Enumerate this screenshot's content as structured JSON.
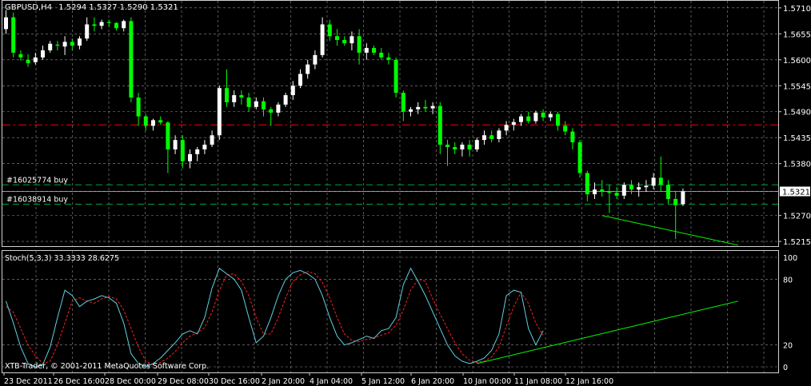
{
  "header": {
    "title": "GBPUSD,H4",
    "ohlc": "1.5294 1.5327 1.5290 1.5321"
  },
  "footer": {
    "copyright": "XTB-Trader, © 2001-2011 MetaQuotes Software Corp."
  },
  "orders": [
    {
      "label": "#16025774 buy",
      "price": 1.5335
    },
    {
      "label": "#16038914 buy",
      "price": 1.5294
    }
  ],
  "colors": {
    "background": "#000000",
    "bull": "#ffffff",
    "bear": "#00ff00",
    "grid": "#c0c0c0",
    "resistance": "#ff0000",
    "order_line": "#00a040",
    "stoch_main": "#5fd0e0",
    "stoch_signal": "#ff2020",
    "trendline": "#00ff00"
  },
  "chart_data": [
    {
      "type": "candlestick",
      "title": "GBPUSD,H4",
      "symbol": "GBPUSD",
      "timeframe": "H4",
      "current_price": "1.5321",
      "y_ticks": [
        "1.5710",
        "1.5655",
        "1.5600",
        "1.5545",
        "1.5490",
        "1.5435",
        "1.5380",
        "1.5321",
        "1.5270",
        "1.5215"
      ],
      "ylim": [
        1.5205,
        1.5725
      ],
      "grid": true,
      "resistance_level": 1.5462,
      "candles": [
        [
          1.5665,
          1.5705,
          1.5655,
          1.569
        ],
        [
          1.569,
          1.57,
          1.5605,
          1.5615
        ],
        [
          1.5612,
          1.562,
          1.5598,
          1.5605
        ],
        [
          1.56,
          1.5612,
          1.5585,
          1.5593
        ],
        [
          1.5595,
          1.5615,
          1.559,
          1.5605
        ],
        [
          1.5605,
          1.563,
          1.56,
          1.562
        ],
        [
          1.562,
          1.564,
          1.5615,
          1.5634
        ],
        [
          1.5632,
          1.564,
          1.562,
          1.563
        ],
        [
          1.5628,
          1.565,
          1.561,
          1.5638
        ],
        [
          1.5638,
          1.5645,
          1.562,
          1.563
        ],
        [
          1.563,
          1.565,
          1.5622,
          1.5645
        ],
        [
          1.5645,
          1.569,
          1.564,
          1.5675
        ],
        [
          1.5675,
          1.569,
          1.566,
          1.5672
        ],
        [
          1.5672,
          1.5685,
          1.5665,
          1.568
        ],
        [
          1.568,
          1.5685,
          1.567,
          1.5678
        ],
        [
          1.5678,
          1.568,
          1.5662,
          1.5667
        ],
        [
          1.5667,
          1.5685,
          1.566,
          1.5682
        ],
        [
          1.5682,
          1.569,
          1.551,
          1.552
        ],
        [
          1.552,
          1.553,
          1.546,
          1.548
        ],
        [
          1.548,
          1.5485,
          1.545,
          1.546
        ],
        [
          1.546,
          1.5475,
          1.545,
          1.5472
        ],
        [
          1.5472,
          1.548,
          1.5462,
          1.5467
        ],
        [
          1.5467,
          1.547,
          1.536,
          1.541
        ],
        [
          1.541,
          1.544,
          1.54,
          1.543
        ],
        [
          1.543,
          1.544,
          1.537,
          1.5385
        ],
        [
          1.5385,
          1.541,
          1.537,
          1.54
        ],
        [
          1.54,
          1.5415,
          1.5385,
          1.541
        ],
        [
          1.541,
          1.543,
          1.54,
          1.542
        ],
        [
          1.542,
          1.545,
          1.5415,
          1.544
        ],
        [
          1.544,
          1.5545,
          1.543,
          1.554
        ],
        [
          1.554,
          1.558,
          1.55,
          1.551
        ],
        [
          1.551,
          1.5535,
          1.55,
          1.5525
        ],
        [
          1.5525,
          1.5535,
          1.5505,
          1.552
        ],
        [
          1.552,
          1.553,
          1.549,
          1.55
        ],
        [
          1.55,
          1.552,
          1.5495,
          1.5512
        ],
        [
          1.5512,
          1.552,
          1.548,
          1.5495
        ],
        [
          1.5495,
          1.55,
          1.546,
          1.5488
        ],
        [
          1.5488,
          1.551,
          1.548,
          1.5505
        ],
        [
          1.5505,
          1.553,
          1.55,
          1.5525
        ],
        [
          1.5525,
          1.5555,
          1.5515,
          1.5545
        ],
        [
          1.5545,
          1.558,
          1.554,
          1.557
        ],
        [
          1.557,
          1.56,
          1.556,
          1.559
        ],
        [
          1.559,
          1.562,
          1.558,
          1.561
        ],
        [
          1.561,
          1.569,
          1.5605,
          1.5675
        ],
        [
          1.5675,
          1.5685,
          1.564,
          1.565
        ],
        [
          1.565,
          1.5665,
          1.563,
          1.5642
        ],
        [
          1.5642,
          1.565,
          1.563,
          1.5635
        ],
        [
          1.5635,
          1.566,
          1.562,
          1.565
        ],
        [
          1.565,
          1.5665,
          1.559,
          1.5615
        ],
        [
          1.5615,
          1.5635,
          1.56,
          1.5625
        ],
        [
          1.5625,
          1.563,
          1.561,
          1.5615
        ],
        [
          1.5615,
          1.5625,
          1.56,
          1.5605
        ],
        [
          1.5605,
          1.5615,
          1.559,
          1.56
        ],
        [
          1.56,
          1.5605,
          1.552,
          1.553
        ],
        [
          1.553,
          1.5535,
          1.547,
          1.549
        ],
        [
          1.549,
          1.55,
          1.548,
          1.5495
        ],
        [
          1.5495,
          1.551,
          1.5485,
          1.55
        ],
        [
          1.55,
          1.5515,
          1.549,
          1.5497
        ],
        [
          1.5497,
          1.551,
          1.5485,
          1.5502
        ],
        [
          1.5502,
          1.551,
          1.54,
          1.542
        ],
        [
          1.542,
          1.543,
          1.5375,
          1.5415
        ],
        [
          1.5415,
          1.5425,
          1.54,
          1.541
        ],
        [
          1.541,
          1.5425,
          1.5395,
          1.542
        ],
        [
          1.542,
          1.543,
          1.5395,
          1.541
        ],
        [
          1.541,
          1.5435,
          1.5405,
          1.543
        ],
        [
          1.543,
          1.545,
          1.542,
          1.544
        ],
        [
          1.544,
          1.545,
          1.5425,
          1.5432
        ],
        [
          1.5432,
          1.5455,
          1.5425,
          1.545
        ],
        [
          1.545,
          1.547,
          1.544,
          1.5462
        ],
        [
          1.5462,
          1.5475,
          1.545,
          1.5468
        ],
        [
          1.5468,
          1.5485,
          1.546,
          1.548
        ],
        [
          1.548,
          1.549,
          1.5465,
          1.547
        ],
        [
          1.547,
          1.5492,
          1.5465,
          1.5488
        ],
        [
          1.5488,
          1.5495,
          1.547,
          1.5478
        ],
        [
          1.5478,
          1.549,
          1.547,
          1.5485
        ],
        [
          1.5485,
          1.549,
          1.545,
          1.546
        ],
        [
          1.546,
          1.547,
          1.544,
          1.5448
        ],
        [
          1.5448,
          1.5455,
          1.541,
          1.5425
        ],
        [
          1.5425,
          1.543,
          1.535,
          1.536
        ],
        [
          1.536,
          1.5365,
          1.53,
          1.5315
        ],
        [
          1.5315,
          1.534,
          1.5305,
          1.5325
        ],
        [
          1.5325,
          1.5345,
          1.531,
          1.532
        ],
        [
          1.532,
          1.5335,
          1.5275,
          1.5318
        ],
        [
          1.5318,
          1.533,
          1.5305,
          1.5312
        ],
        [
          1.5312,
          1.534,
          1.5305,
          1.5335
        ],
        [
          1.5335,
          1.5345,
          1.5315,
          1.5325
        ],
        [
          1.5325,
          1.534,
          1.531,
          1.533
        ],
        [
          1.533,
          1.5345,
          1.532,
          1.5333
        ],
        [
          1.5333,
          1.536,
          1.5325,
          1.535
        ],
        [
          1.535,
          1.5395,
          1.532,
          1.5335
        ],
        [
          1.5335,
          1.5345,
          1.5295,
          1.5305
        ],
        [
          1.5305,
          1.532,
          1.522,
          1.5292
        ],
        [
          1.5294,
          1.5327,
          1.529,
          1.5321
        ]
      ],
      "trendline": {
        "from": [
          81,
          1.527
        ],
        "to": [
          99.5,
          1.5207
        ]
      }
    },
    {
      "type": "line",
      "title": "Stoch(5,3,3) 33.3333 28.6275",
      "indicator": "Stoch(5,3,3)",
      "main_value": "33.3333",
      "signal_value": "28.6275",
      "y_ticks": [
        "100",
        "80",
        "20",
        "0"
      ],
      "levels": [
        80,
        20
      ],
      "ylim": [
        0,
        100
      ],
      "grid": true,
      "series": [
        {
          "values": [
            60,
            40,
            18,
            3,
            0,
            2,
            18,
            45,
            70,
            65,
            55,
            60,
            62,
            65,
            63,
            58,
            40,
            12,
            3,
            0,
            3,
            8,
            15,
            22,
            30,
            33,
            30,
            45,
            72,
            90,
            85,
            80,
            70,
            45,
            22,
            28,
            45,
            65,
            80,
            86,
            88,
            85,
            80,
            65,
            45,
            28,
            20,
            22,
            25,
            28,
            26,
            33,
            35,
            45,
            75,
            90,
            78,
            65,
            50,
            35,
            20,
            10,
            5,
            3,
            5,
            8,
            15,
            30,
            65,
            70,
            68,
            35,
            20,
            33
          ]
        },
        {
          "values": [
            55,
            50,
            35,
            20,
            10,
            3,
            5,
            20,
            40,
            60,
            63,
            60,
            58,
            62,
            64,
            62,
            52,
            35,
            18,
            5,
            2,
            4,
            8,
            14,
            22,
            28,
            31,
            36,
            50,
            70,
            84,
            85,
            78,
            65,
            45,
            30,
            30,
            45,
            63,
            78,
            84,
            87,
            85,
            77,
            63,
            45,
            30,
            24,
            23,
            25,
            26,
            29,
            31,
            38,
            52,
            70,
            80,
            78,
            62,
            48,
            35,
            22,
            12,
            6,
            4,
            5,
            9,
            18,
            37,
            55,
            68,
            58,
            40,
            29
          ]
        }
      ],
      "trendline": {
        "from": [
          64,
          3
        ],
        "to": [
          99.5,
          60
        ]
      }
    }
  ],
  "x_axis": {
    "labels": [
      "23 Dec 2011",
      "26 Dec 16:00",
      "28 Dec 00:00",
      "29 Dec 08:00",
      "30 Dec 16:00",
      "2 Jan 20:00",
      "4 Jan 04:00",
      "5 Jan 12:00",
      "6 Jan 20:00",
      "10 Jan 00:00",
      "11 Jan 08:00",
      "12 Jan 16:00"
    ]
  }
}
